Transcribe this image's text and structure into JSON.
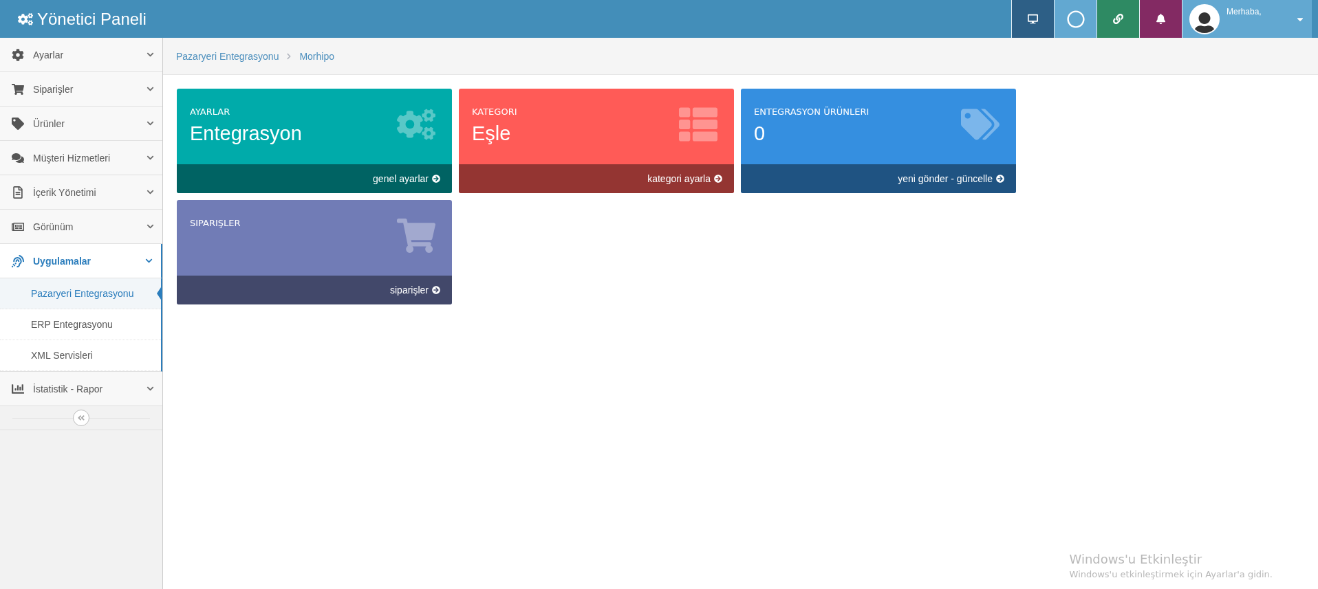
{
  "header": {
    "title": "Yönetici Paneli",
    "buttons": [
      {
        "color": "#2d5f86"
      },
      {
        "color": "#62a8d1"
      },
      {
        "color": "#2e8a63"
      },
      {
        "color": "#832a63"
      }
    ],
    "user": {
      "greeting": "Merhaba,"
    }
  },
  "sidebar": {
    "items": [
      {
        "label": "Ayarlar",
        "expanded": false
      },
      {
        "label": "Siparişler",
        "expanded": false
      },
      {
        "label": "Ürünler",
        "expanded": false
      },
      {
        "label": "Müşteri Hizmetleri",
        "expanded": false
      },
      {
        "label": "İçerik Yönetimi",
        "expanded": false
      },
      {
        "label": "Görünüm",
        "expanded": false
      },
      {
        "label": "Uygulamalar",
        "expanded": true,
        "children": [
          {
            "label": "Pazaryeri Entegrasyonu",
            "selected": true
          },
          {
            "label": "ERP Entegrasyonu",
            "selected": false
          },
          {
            "label": "XML Servisleri",
            "selected": false
          }
        ]
      },
      {
        "label": "İstatistik - Rapor",
        "expanded": false
      }
    ]
  },
  "breadcrumb": [
    "Pazaryeri Entegrasyonu",
    "Morhipo"
  ],
  "cards": [
    {
      "caption": "AYARLAR",
      "value": "Entegrasyon",
      "link": "genel ayarlar",
      "color": "#00abaa"
    },
    {
      "caption": "KATEGORI",
      "value": "Eşle",
      "link": "kategori ayarla",
      "color": "#ff5b57"
    },
    {
      "caption": "ENTEGRASYON ÜRÜNLERI",
      "value": "0",
      "link": "yeni gönder - güncelle",
      "color": "#358fe0"
    },
    {
      "caption": "SIPARIŞLER",
      "link": "siparişler",
      "color": "#717cb6"
    }
  ],
  "activation_notice": {
    "title": "Windows'u Etkinleştir",
    "text": "Windows'u etkinleştirmek için Ayarlar'a gidin."
  }
}
